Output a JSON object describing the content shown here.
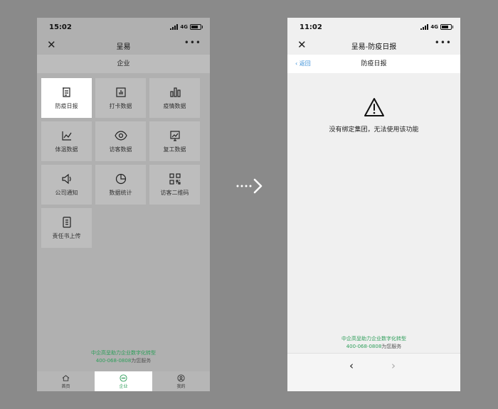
{
  "left_phone": {
    "status_time": "15:02",
    "network": "4G",
    "nav_title": "呈易",
    "sub_header": "企业",
    "tiles": [
      {
        "label": "防疫日报",
        "icon": "document-icon",
        "active": true
      },
      {
        "label": "打卡数据",
        "icon": "bar-chart-icon",
        "active": false
      },
      {
        "label": "疫情数据",
        "icon": "column-chart-icon",
        "active": false
      },
      {
        "label": "体温数据",
        "icon": "line-chart-icon",
        "active": false
      },
      {
        "label": "访客数据",
        "icon": "eye-icon",
        "active": false
      },
      {
        "label": "复工数据",
        "icon": "trend-icon",
        "active": false
      },
      {
        "label": "公司通知",
        "icon": "speaker-icon",
        "active": false
      },
      {
        "label": "数据统计",
        "icon": "pie-chart-icon",
        "active": false
      },
      {
        "label": "访客二维码",
        "icon": "qr-code-icon",
        "active": false
      },
      {
        "label": "责任书上传",
        "icon": "upload-doc-icon",
        "active": false
      }
    ],
    "footer": {
      "brand": "中企高呈",
      "rest": "助力企业数字化转型",
      "phone": "400-068-0808",
      "phone_suffix": "为您服务"
    },
    "tabs": [
      {
        "label": "首页",
        "icon": "home-icon",
        "active": false
      },
      {
        "label": "企业",
        "icon": "chat-icon",
        "active": true
      },
      {
        "label": "我的",
        "icon": "profile-icon",
        "active": false
      }
    ]
  },
  "right_phone": {
    "status_time": "11:02",
    "network": "4G",
    "nav_title": "呈易-防疫日报",
    "back_label": "返回",
    "page_title": "防疫日报",
    "warning_text": "没有绑定集团，无法使用该功能",
    "footer": {
      "brand": "中企高呈",
      "rest": "助力企业数字化转型",
      "phone": "400-068-0808",
      "phone_suffix": "为您服务"
    }
  },
  "colors": {
    "accent": "#2e9e5a",
    "link": "#3a8fd8",
    "backdrop": "#8a8a8a"
  }
}
